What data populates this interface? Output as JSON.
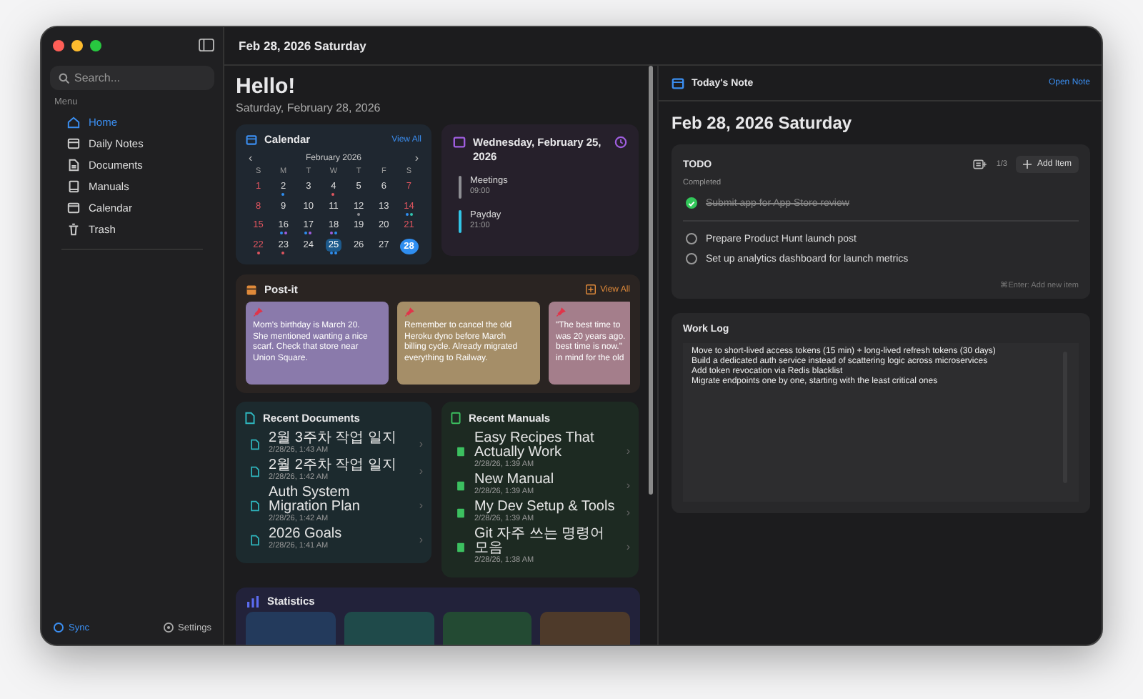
{
  "sidebar": {
    "search": {
      "placeholder": "Search..."
    },
    "section": "Menu",
    "items": [
      {
        "label": "Home",
        "kind": "home",
        "selected": true
      },
      {
        "label": "Daily Notes",
        "kind": "notes",
        "selected": false
      },
      {
        "label": "Documents",
        "kind": "document",
        "selected": false
      },
      {
        "label": "Manuals",
        "kind": "book",
        "selected": false
      },
      {
        "label": "Calendar",
        "kind": "calendar",
        "selected": false
      },
      {
        "label": "Trash",
        "kind": "trash",
        "selected": false
      }
    ],
    "sync": "Sync",
    "settings": "Settings"
  },
  "topbar": {
    "title": "Feb 28, 2026 Saturday"
  },
  "greeting": {
    "title": "Hello!",
    "date": "Saturday, February 28, 2026"
  },
  "calendar": {
    "title": "Calendar",
    "view_all": "View All",
    "month": "February 2026",
    "prev": "‹",
    "next": "›",
    "weekdays": [
      "S",
      "M",
      "T",
      "W",
      "T",
      "F",
      "S"
    ],
    "days": [
      {
        "label": "1",
        "selected": false,
        "today": false
      },
      {
        "label": "2",
        "selected": false,
        "today": false,
        "dots": [
          {
            "color": "#2f8ef0"
          }
        ]
      },
      {
        "label": "3",
        "selected": false,
        "today": false
      },
      {
        "label": "4",
        "selected": false,
        "today": false,
        "dots": [
          {
            "color": "#e0555f"
          }
        ]
      },
      {
        "label": "5",
        "selected": false,
        "today": false
      },
      {
        "label": "6",
        "selected": false,
        "today": false
      },
      {
        "label": "7",
        "selected": false,
        "today": false
      },
      {
        "label": "8",
        "selected": false,
        "today": false
      },
      {
        "label": "9",
        "selected": false,
        "today": false
      },
      {
        "label": "10",
        "selected": false,
        "today": false
      },
      {
        "label": "11",
        "selected": false,
        "today": false
      },
      {
        "label": "12",
        "selected": false,
        "today": false,
        "dots": [
          {
            "color": "#8e8e93"
          }
        ]
      },
      {
        "label": "13",
        "selected": false,
        "today": false
      },
      {
        "label": "14",
        "selected": false,
        "today": false,
        "dots": [
          {
            "color": "#2f8ef0"
          },
          {
            "color": "#32c5b0"
          }
        ]
      },
      {
        "label": "15",
        "selected": false,
        "today": false
      },
      {
        "label": "16",
        "selected": false,
        "today": false,
        "dots": [
          {
            "color": "#2f8ef0"
          },
          {
            "color": "#a05ee0"
          }
        ]
      },
      {
        "label": "17",
        "selected": false,
        "today": false,
        "dots": [
          {
            "color": "#2f8ef0"
          },
          {
            "color": "#a05ee0"
          }
        ]
      },
      {
        "label": "18",
        "selected": false,
        "today": false,
        "dots": [
          {
            "color": "#a05ee0"
          },
          {
            "color": "#2f8ef0"
          }
        ]
      },
      {
        "label": "19",
        "selected": false,
        "today": false
      },
      {
        "label": "20",
        "selected": false,
        "today": false
      },
      {
        "label": "21",
        "selected": false,
        "today": false
      },
      {
        "label": "22",
        "selected": false,
        "today": false,
        "dots": [
          {
            "color": "#e0555f"
          }
        ]
      },
      {
        "label": "23",
        "selected": false,
        "today": false,
        "dots": [
          {
            "color": "#e0555f"
          }
        ]
      },
      {
        "label": "24",
        "selected": false,
        "today": false
      },
      {
        "label": "25",
        "selected": true,
        "today": false,
        "dots": [
          {
            "color": "#2f8ef0"
          },
          {
            "color": "#2f8ef0"
          }
        ]
      },
      {
        "label": "26",
        "selected": false,
        "today": false
      },
      {
        "label": "27",
        "selected": false,
        "today": false
      },
      {
        "label": "28",
        "selected": false,
        "today": true
      }
    ]
  },
  "day_panel": {
    "title": "Wednesday, February 25, 2026",
    "events": [
      {
        "name": "Meetings",
        "time": "09:00",
        "color": "#8e8e93"
      },
      {
        "name": "Payday",
        "time": "21:00",
        "color": "#32c5e6"
      }
    ]
  },
  "postit": {
    "title": "Post-it",
    "view_all": "View All",
    "notes": [
      {
        "color": "#8a7aab",
        "lines": [
          "Mom's birthday is March 20.",
          "She mentioned wanting a nice",
          "scarf. Check that store near",
          "Union Square."
        ]
      },
      {
        "color": "#a58e68",
        "lines": [
          "Remember to cancel the old",
          "Heroku dyno before March",
          "billing cycle. Already migrated",
          "everything to Railway."
        ]
      },
      {
        "color": "#a47e8b",
        "lines": [
          "\"The best time to",
          "was 20 years ago.",
          "best time is now.\"",
          "in mind for the old"
        ]
      }
    ]
  },
  "recent_documents": {
    "title": "Recent Documents",
    "chevron": "›",
    "items": [
      {
        "title": "2월 3주차 작업 일지",
        "date": "2/28/26, 1:43 AM"
      },
      {
        "title": "2월 2주차 작업 일지",
        "date": "2/28/26, 1:42 AM"
      },
      {
        "title": "Auth System Migration Plan",
        "date": "2/28/26, 1:42 AM"
      },
      {
        "title": "2026 Goals",
        "date": "2/28/26, 1:41 AM"
      }
    ]
  },
  "recent_manuals": {
    "title": "Recent Manuals",
    "chevron": "›",
    "items": [
      {
        "title": "Easy Recipes That Actually Work",
        "date": "2/28/26, 1:39 AM"
      },
      {
        "title": "New Manual",
        "date": "2/28/26, 1:39 AM"
      },
      {
        "title": "My Dev Setup & Tools",
        "date": "2/28/26, 1:39 AM"
      },
      {
        "title": "Git 자주 쓰는 명령어 모음",
        "date": "2/28/26, 1:38 AM"
      }
    ]
  },
  "statistics": {
    "title": "Statistics",
    "tiles": [
      {
        "color": "#233a5c"
      },
      {
        "color": "#1f4a4a"
      },
      {
        "color": "#234a33"
      },
      {
        "color": "#4e3a2a"
      }
    ]
  },
  "today_note": {
    "header": "Today's Note",
    "open": "Open Note",
    "title": "Feb 28, 2026 Saturday",
    "todo": {
      "title": "TODO",
      "count": "1/3",
      "add": "Add Item",
      "completed_label": "Completed",
      "items": [
        {
          "text": "Submit app for App Store review",
          "checked": true
        },
        {
          "text": "Prepare Product Hunt launch post",
          "checked": false
        },
        {
          "text": "Set up analytics dashboard for launch metrics",
          "checked": false
        }
      ],
      "hint": "⌘Enter: Add new item"
    },
    "work_log": {
      "title": "Work Log",
      "lines": [
        "Move to short-lived access tokens (15 min) + long-lived refresh tokens (30 days)",
        "Build a dedicated auth service instead of scattering logic across microservices",
        "Add token revocation via Redis blacklist",
        "Migrate endpoints one by one, starting with the least critical ones"
      ]
    }
  }
}
